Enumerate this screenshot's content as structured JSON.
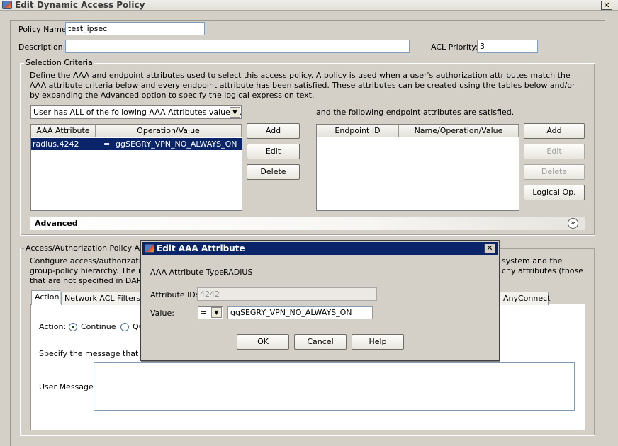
{
  "window": {
    "title": "Edit Dynamic Access Policy",
    "close_label": "✕"
  },
  "policy": {
    "name_label": "Policy Name:",
    "name_value": "test_ipsec",
    "description_label": "Description:",
    "description_value": "",
    "acl_priority_label": "ACL Priority:",
    "acl_priority_value": "3"
  },
  "selection": {
    "group_title": "Selection Criteria",
    "description": "Define the AAA and endpoint attributes used to select this access policy. A policy is used when a user's authorization attributes match the AAA attribute criteria below and every endpoint attribute has been satisfied. These attributes can be created using the tables below and/or by expanding the Advanced option to specify the logical expression text.",
    "match_mode": "User has ALL of the following AAA Attributes values...",
    "endpoint_caption": "and the following endpoint attributes are satisfied.",
    "aaa_table": {
      "columns": [
        "AAA Attribute",
        "Operation/Value"
      ],
      "rows": [
        {
          "attribute": "radius.4242",
          "operator": "=",
          "value": "ggSEGRY_VPN_NO_ALWAYS_ON"
        }
      ]
    },
    "aaa_buttons": {
      "add": "Add",
      "edit": "Edit",
      "delete": "Delete"
    },
    "endpoint_table": {
      "columns": [
        "Endpoint ID",
        "Name/Operation/Value"
      ],
      "rows": []
    },
    "endpoint_buttons": {
      "add": "Add",
      "edit": "Edit",
      "delete": "Delete",
      "logical": "Logical Op."
    },
    "advanced_label": "Advanced"
  },
  "access": {
    "group_title": "Access/Authorization Policy Attrib",
    "desc_line1": "Configure access/authorization a",
    "desc_line1_right": "system and the",
    "desc_line2": "group-policy hierarchy. The resu",
    "desc_line2_right": "chy attributes (those",
    "desc_line3": "that are not specified in DAP).",
    "tabs": [
      "Action",
      "Network ACL Filters (c",
      "AnyConnect"
    ],
    "action_label": "Action:",
    "action_options": [
      "Continue",
      "Qu"
    ],
    "message_prompt": "Specify the message that will",
    "user_message_label": "User Message:",
    "user_message_value": ""
  },
  "dialog": {
    "title": "Edit AAA Attribute",
    "attribute_type_label": "AAA Attribute Type:",
    "attribute_type_value": "RADIUS",
    "attribute_id_label": "Attribute ID:",
    "attribute_id_value": "4242",
    "value_label": "Value:",
    "operator_value": "=",
    "value_text": "ggSEGRY_VPN_NO_ALWAYS_ON",
    "ok_label": "OK",
    "cancel_label": "Cancel",
    "help_label": "Help",
    "close_label": "✕"
  }
}
